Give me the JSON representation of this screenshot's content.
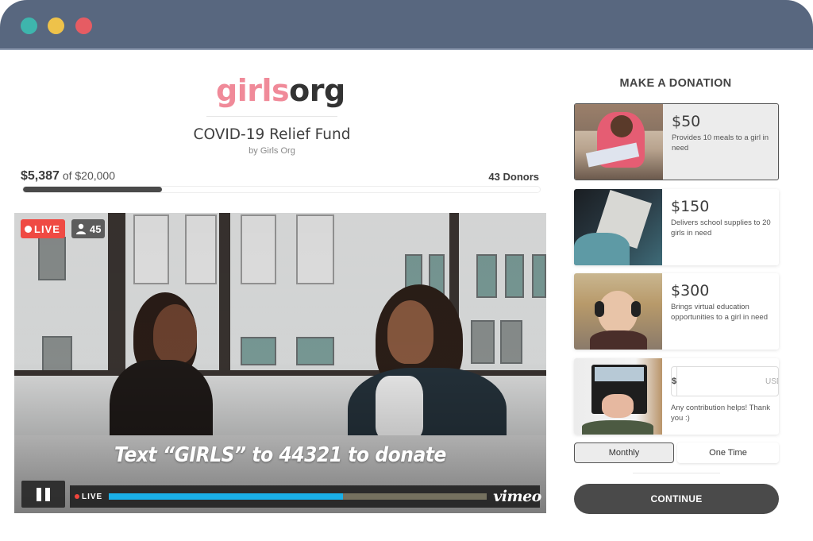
{
  "window": {
    "controls": [
      "close",
      "minimize",
      "maximize"
    ],
    "colors": {
      "titlebar": "#58677f",
      "teal": "#3eb5ad",
      "yellow": "#eec24a",
      "red": "#e65c63"
    }
  },
  "campaign": {
    "logo_part1": "girls",
    "logo_part2": "org",
    "title": "COVID-19 Relief Fund",
    "byline": "by Girls Org",
    "raised": "$5,387",
    "goal_text": "of $20,000",
    "donors": "43 Donors",
    "progress_fraction": 0.269
  },
  "video": {
    "live_label": "LIVE",
    "viewer_count": "45",
    "overlay_text": "Text “GIRLS” to 44321 to donate",
    "controls_live_label": "LIVE",
    "progress_fraction": 0.62,
    "brand": "vimeo",
    "icons": [
      "live-dot-icon",
      "user-icon",
      "pause-icon"
    ],
    "colors": {
      "live": "#ef4a43",
      "progress": "#1ab0e8"
    }
  },
  "donation": {
    "title": "MAKE A DONATION",
    "options": [
      {
        "amount": "$50",
        "description": "Provides 10 meals to a girl in need",
        "selected": true
      },
      {
        "amount": "$150",
        "description": "Delivers school supplies to 20 girls in need",
        "selected": false
      },
      {
        "amount": "$300",
        "description": "Brings virtual education opportunities to a girl in need",
        "selected": false
      }
    ],
    "custom": {
      "prefix": "$",
      "placeholder": "USD",
      "value": "",
      "note": "Any contribution helps! Thank you :)"
    },
    "frequency": {
      "monthly_label": "Monthly",
      "onetime_label": "One Time",
      "selected": "Monthly"
    },
    "continue_label": "CONTINUE"
  }
}
